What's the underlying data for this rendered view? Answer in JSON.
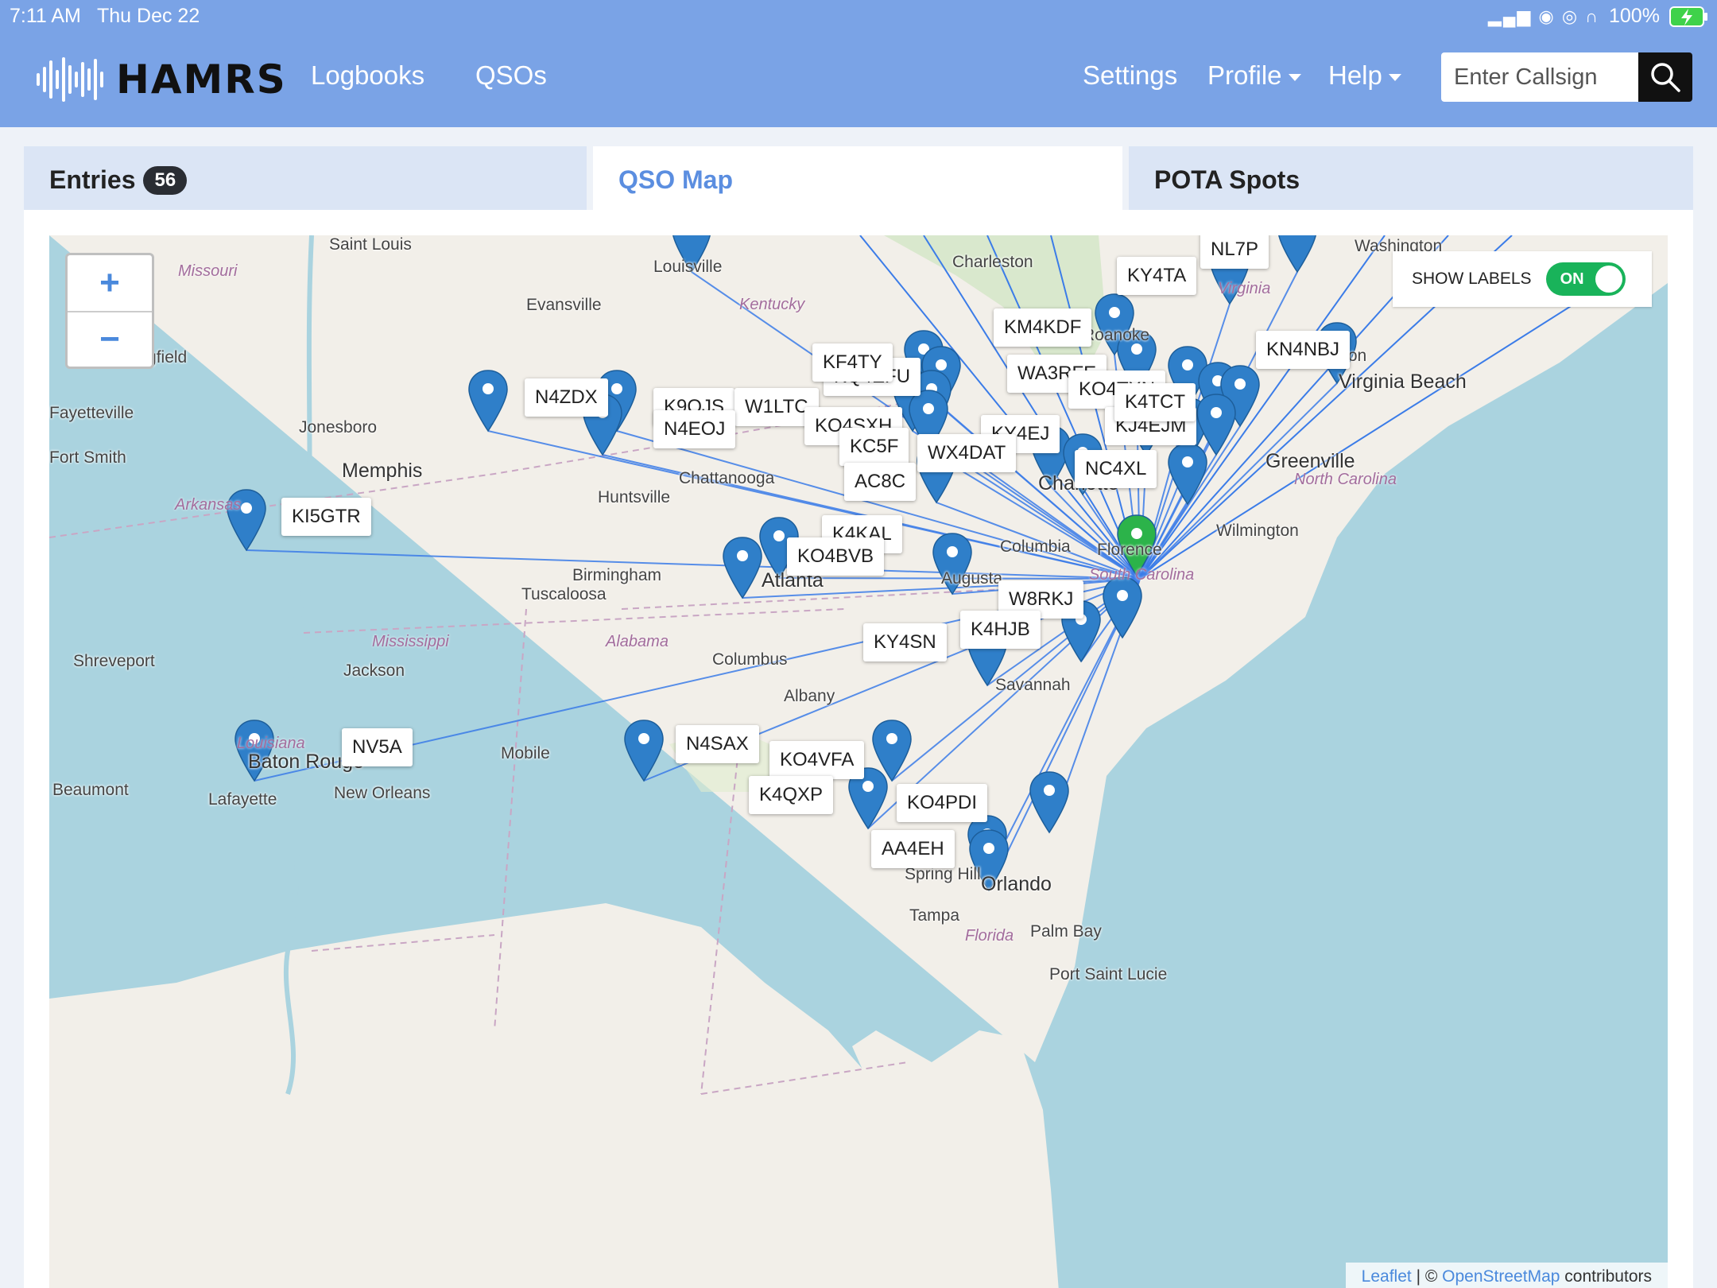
{
  "status": {
    "time": "7:11 AM",
    "date": "Thu Dec 22",
    "battery": "100%"
  },
  "nav": {
    "brand": "HAMRS",
    "links": [
      "Logbooks",
      "QSOs"
    ],
    "settings": "Settings",
    "profile": "Profile",
    "help": "Help",
    "search_placeholder": "Enter Callsign"
  },
  "tabs": {
    "entries": "Entries",
    "entries_count": "56",
    "map": "QSO Map",
    "pota": "POTA Spots"
  },
  "map": {
    "zoom_in": "+",
    "zoom_out": "−",
    "show_labels": "SHOW LABELS",
    "toggle": "ON",
    "attribution": {
      "leaflet": "Leaflet",
      "sep": " | © ",
      "osm": "OpenStreetMap",
      "suffix": " contributors"
    },
    "labels": [
      "NL7P",
      "KY4TA",
      "KM4KDF",
      "KN4NBJ",
      "WA3RFE",
      "KO4TXN",
      "KQ4EFU",
      "KJ4EJM",
      "N4ZDX",
      "K9QJS",
      "W1LTC",
      "KO4SXH",
      "KY4EJ",
      "KC5F",
      "WX4DAT",
      "NC4XL",
      "AC8C",
      "KI5GTR",
      "K4KAL",
      "KO4BVB",
      "W8RKJ",
      "K4HJB",
      "KY4SN",
      "NV5A",
      "N4SAX",
      "KO4VFA",
      "K4QXP",
      "KO4PDI",
      "AA4EH",
      "KF4TY",
      "N4EOJ",
      "K4TCT"
    ],
    "cities": [
      "Saint Louis",
      "Louisville",
      "Charleston",
      "Evansville",
      "Springfield",
      "Fayetteville",
      "Jonesboro",
      "Fort Smith",
      "Memphis",
      "Chattanooga",
      "Huntsville",
      "Birmingham",
      "Tuscaloosa",
      "Atlanta",
      "Columbia",
      "Florence",
      "Augusta",
      "Wilmington",
      "Greenville",
      "Virginia Beach",
      "Charlotte",
      "Shreveport",
      "Jackson",
      "Columbus",
      "Albany",
      "Savannah",
      "Baton Rouge",
      "Mobile",
      "New Orleans",
      "Lafayette",
      "Beaumont",
      "Orlando",
      "Tampa",
      "Palm Bay",
      "Spring Hill",
      "Port Saint Lucie",
      "Roanoke",
      "Hampton",
      "Washington"
    ],
    "states": [
      "Missouri",
      "Kentucky",
      "Arkansas",
      "Mississippi",
      "Alabama",
      "Louisiana",
      "Florida",
      "South Carolina",
      "North Carolina",
      "Virginia"
    ],
    "colors": {
      "line": "#3b7ce8",
      "marker": "#2f7fc9",
      "home": "#2cb34a"
    }
  }
}
